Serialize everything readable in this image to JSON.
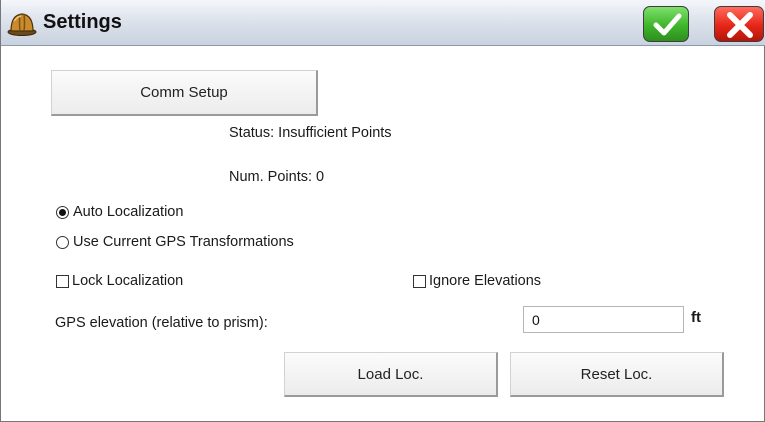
{
  "window": {
    "title": "Settings",
    "icon": "hard-hat-icon",
    "ok_icon": "checkmark-icon",
    "cancel_icon": "close-x-icon"
  },
  "buttons": {
    "comm_setup": "Comm Setup",
    "load_loc": "Load Loc.",
    "reset_loc": "Reset Loc."
  },
  "status": {
    "status_text": "Status: Insufficient Points",
    "num_points_text": "Num. Points: 0"
  },
  "localization_mode": {
    "options": [
      {
        "label": "Auto Localization",
        "selected": true
      },
      {
        "label": "Use Current GPS Transformations",
        "selected": false
      }
    ]
  },
  "checkboxes": {
    "lock_localization": {
      "label": "Lock Localization",
      "checked": false
    },
    "ignore_elevations": {
      "label": "Ignore Elevations",
      "checked": false
    }
  },
  "elevation": {
    "label": "GPS elevation (relative to prism):",
    "value": "0",
    "unit": "ft"
  },
  "colors": {
    "ok_green": "#3fb52b",
    "cancel_red": "#e52617",
    "title_bar": "#dde3ec"
  }
}
